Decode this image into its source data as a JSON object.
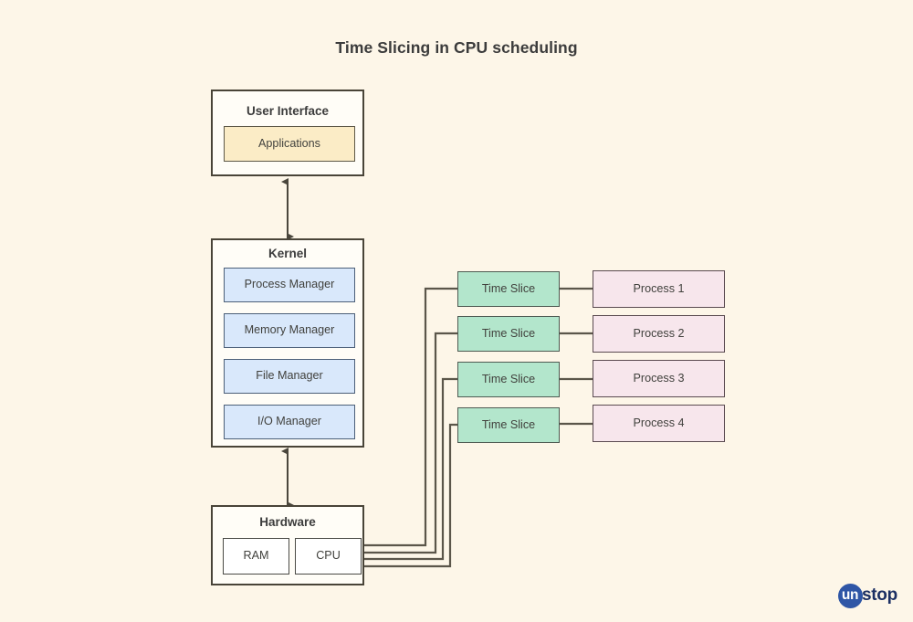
{
  "title": "Time Slicing in CPU scheduling",
  "diagram": {
    "type": "block-diagram",
    "background_color": "#fdf6e8",
    "user_interface": {
      "label": "User Interface",
      "items": [
        {
          "label": "Applications",
          "color": "#fbecc6"
        }
      ]
    },
    "kernel": {
      "label": "Kernel",
      "items": [
        {
          "label": "Process Manager",
          "color": "#d9e8fb"
        },
        {
          "label": "Memory Manager",
          "color": "#d9e8fb"
        },
        {
          "label": "File Manager",
          "color": "#d9e8fb"
        },
        {
          "label": "I/O Manager",
          "color": "#d9e8fb"
        }
      ]
    },
    "hardware": {
      "label": "Hardware",
      "items": [
        {
          "label": "RAM",
          "color": "#ffffff"
        },
        {
          "label": "CPU",
          "color": "#ffffff"
        }
      ]
    },
    "scheduling_rows": [
      {
        "slice_label": "Time Slice",
        "process_label": "Process 1"
      },
      {
        "slice_label": "Time Slice",
        "process_label": "Process 2"
      },
      {
        "slice_label": "Time Slice",
        "process_label": "Process 3"
      },
      {
        "slice_label": "Time Slice",
        "process_label": "Process 4"
      }
    ],
    "connectors": [
      {
        "from": "User Interface",
        "to": "Kernel",
        "style": "double-arrow"
      },
      {
        "from": "Kernel",
        "to": "Hardware",
        "style": "double-arrow"
      },
      {
        "from": "CPU",
        "to": "Time Slice 1",
        "style": "orthogonal-line"
      },
      {
        "from": "CPU",
        "to": "Time Slice 2",
        "style": "orthogonal-line"
      },
      {
        "from": "CPU",
        "to": "Time Slice 3",
        "style": "orthogonal-line"
      },
      {
        "from": "CPU",
        "to": "Time Slice 4",
        "style": "orthogonal-line"
      },
      {
        "from": "Time Slice 1",
        "to": "Process 1",
        "style": "line"
      },
      {
        "from": "Time Slice 2",
        "to": "Process 2",
        "style": "line"
      },
      {
        "from": "Time Slice 3",
        "to": "Process 3",
        "style": "line"
      },
      {
        "from": "Time Slice 4",
        "to": "Process 4",
        "style": "line"
      }
    ]
  },
  "watermark": {
    "mark_text": "un",
    "word_text": "stop",
    "mark_color": "#2f56a6",
    "word_color": "#1b2f63"
  }
}
